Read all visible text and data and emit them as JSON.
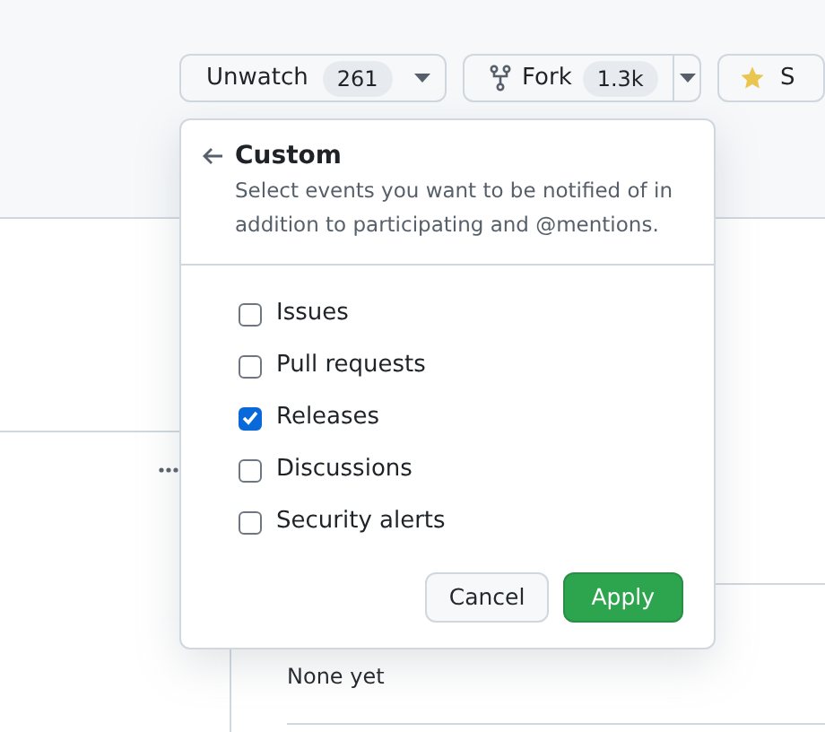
{
  "header_buttons": [
    {
      "kind": "watch",
      "label": "Unwatch",
      "count": "261"
    },
    {
      "kind": "fork",
      "label": "Fork",
      "count": "1.3k"
    },
    {
      "kind": "star",
      "label": "S"
    }
  ],
  "popover": {
    "title": "Custom",
    "description": "Select events you want to be notified of in addition to participating and @mentions.",
    "events": [
      {
        "label": "Issues",
        "checked": false
      },
      {
        "label": "Pull requests",
        "checked": false
      },
      {
        "label": "Releases",
        "checked": true
      },
      {
        "label": "Discussions",
        "checked": false
      },
      {
        "label": "Security alerts",
        "checked": false
      }
    ],
    "buttons": [
      {
        "kind": "secondary",
        "label": "Cancel"
      },
      {
        "kind": "primary",
        "label": "Apply"
      }
    ]
  },
  "background": {
    "text": "None yet"
  }
}
